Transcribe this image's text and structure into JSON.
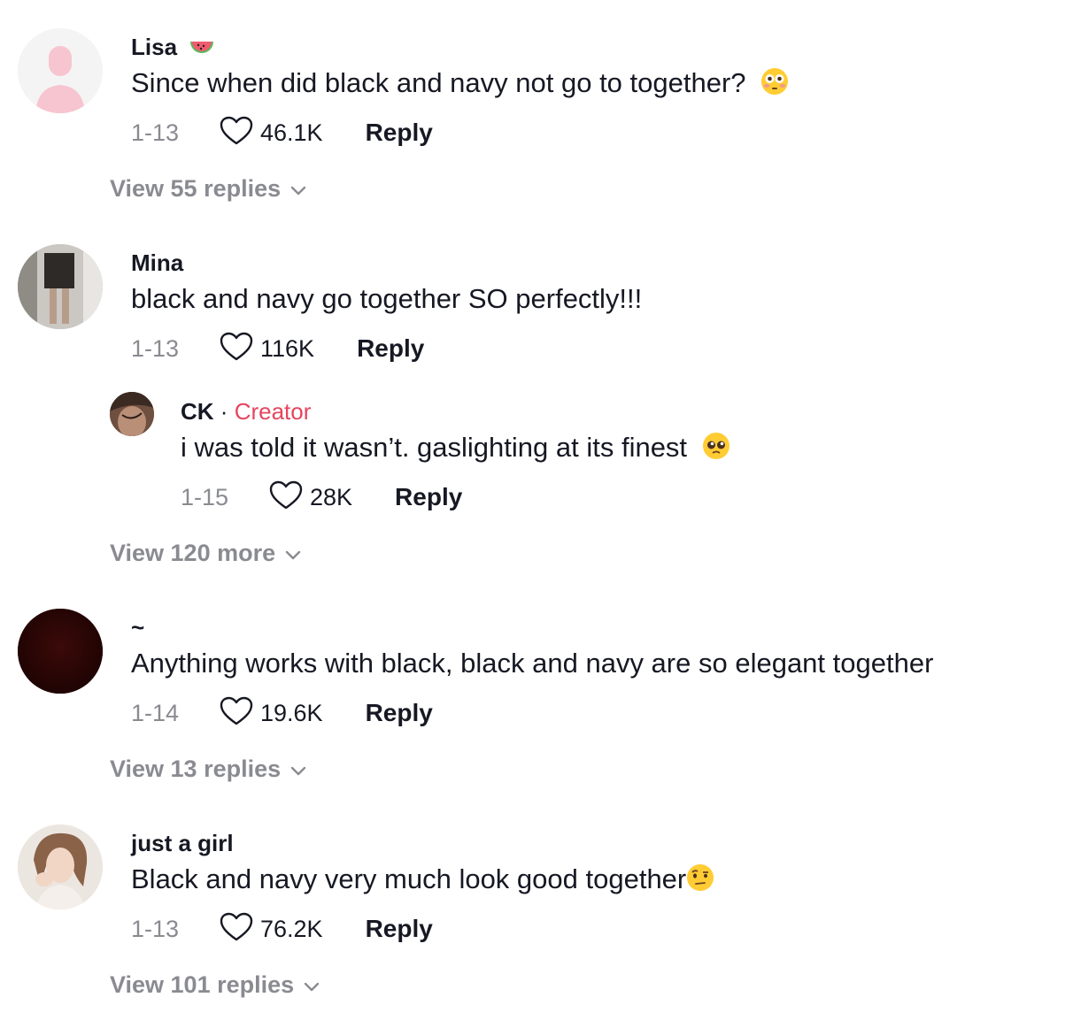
{
  "comments": [
    {
      "username": "Lisa",
      "username_emoji": "watermelon",
      "text": "Since when did black and navy not go to together?",
      "text_emoji": "flushed-face",
      "date": "1-13",
      "likes": "46.1K",
      "reply_label": "Reply",
      "view_replies": "View 55 replies"
    },
    {
      "username": "Mina",
      "text": "black and navy go together SO perfectly!!!",
      "date": "1-13",
      "likes": "116K",
      "reply_label": "Reply",
      "replies": [
        {
          "username": "CK",
          "separator": "·",
          "badge": "Creator",
          "text": "i was told it wasn’t. gaslighting at its finest",
          "text_emoji": "pleading-face",
          "date": "1-15",
          "likes": "28K",
          "reply_label": "Reply"
        }
      ],
      "view_replies": "View 120 more"
    },
    {
      "username": "~",
      "text": "Anything works with black, black and navy are so elegant together",
      "date": "1-14",
      "likes": "19.6K",
      "reply_label": "Reply",
      "view_replies": "View 13 replies"
    },
    {
      "username": "just a girl",
      "text": "Black and navy very much look good together",
      "text_emoji": "face-with-raised-eyebrow",
      "date": "1-13",
      "likes": "76.2K",
      "reply_label": "Reply",
      "view_replies": "View 101 replies"
    }
  ],
  "colors": {
    "text": "#161823",
    "secondary": "#8a8b91",
    "creator_badge": "#e5455f"
  },
  "icons": [
    "heart-outline-icon",
    "chevron-down-icon"
  ]
}
